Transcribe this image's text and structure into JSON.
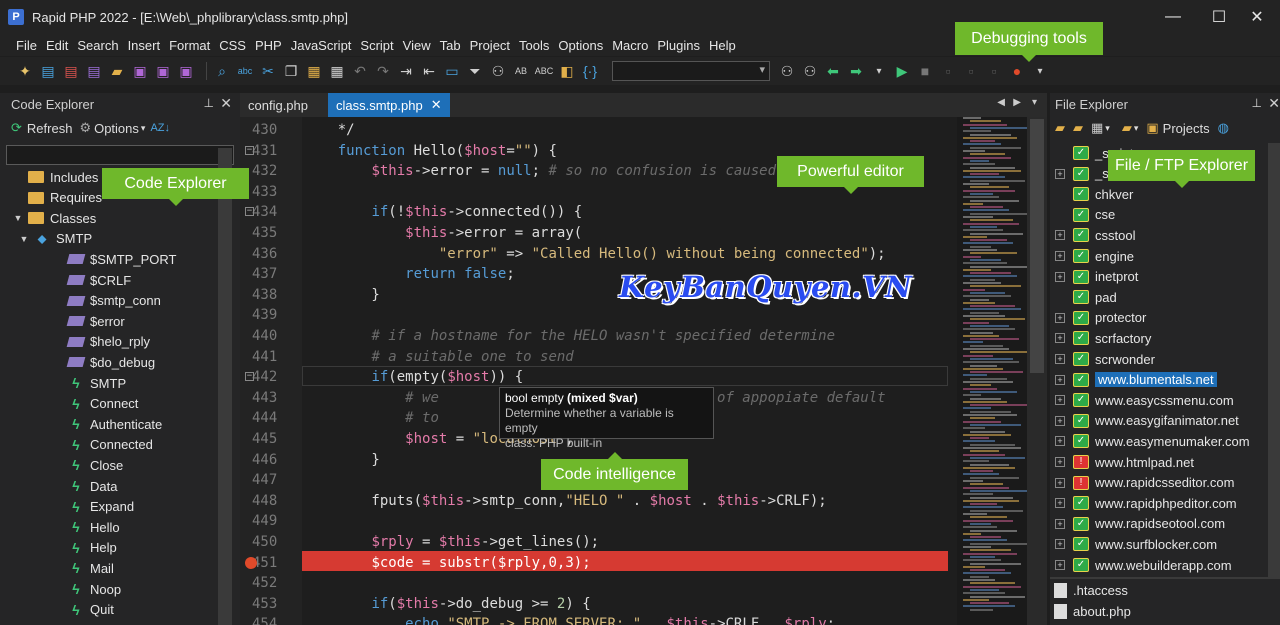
{
  "window": {
    "title": "Rapid PHP 2022 - [E:\\Web\\_phplibrary\\class.smtp.php]",
    "minimize": "—",
    "maximize": "☐",
    "close": "✕"
  },
  "menu": [
    "File",
    "Edit",
    "Search",
    "Insert",
    "Format",
    "CSS",
    "PHP",
    "JavaScript",
    "Script",
    "View",
    "Tab",
    "Project",
    "Tools",
    "Options",
    "Macro",
    "Plugins",
    "Help"
  ],
  "code_explorer": {
    "title": "Code Explorer",
    "refresh": "Refresh",
    "options": "Options",
    "search_placeholder": "",
    "tree": [
      {
        "label": "Includes",
        "type": "folder",
        "level": 0
      },
      {
        "label": "Requires",
        "type": "folder",
        "level": 0
      },
      {
        "label": "Classes",
        "type": "folder",
        "level": 0
      },
      {
        "label": "SMTP",
        "type": "class",
        "level": 1
      },
      {
        "label": "$SMTP_PORT",
        "type": "var",
        "level": 2
      },
      {
        "label": "$CRLF",
        "type": "var",
        "level": 2
      },
      {
        "label": "$smtp_conn",
        "type": "var",
        "level": 2
      },
      {
        "label": "$error",
        "type": "var",
        "level": 2
      },
      {
        "label": "$helo_rply",
        "type": "var",
        "level": 2
      },
      {
        "label": "$do_debug",
        "type": "var",
        "level": 2
      },
      {
        "label": "SMTP",
        "type": "func",
        "level": 2
      },
      {
        "label": "Connect",
        "type": "func",
        "level": 2
      },
      {
        "label": "Authenticate",
        "type": "func",
        "level": 2
      },
      {
        "label": "Connected",
        "type": "func",
        "level": 2
      },
      {
        "label": "Close",
        "type": "func",
        "level": 2
      },
      {
        "label": "Data",
        "type": "func",
        "level": 2
      },
      {
        "label": "Expand",
        "type": "func",
        "level": 2
      },
      {
        "label": "Hello",
        "type": "func",
        "level": 2
      },
      {
        "label": "Help",
        "type": "func",
        "level": 2
      },
      {
        "label": "Mail",
        "type": "func",
        "level": 2
      },
      {
        "label": "Noop",
        "type": "func",
        "level": 2
      },
      {
        "label": "Quit",
        "type": "func",
        "level": 2
      }
    ]
  },
  "tabs": [
    {
      "label": "config.php",
      "active": false
    },
    {
      "label": "class.smtp.php",
      "active": true
    }
  ],
  "editor": {
    "lines": [
      {
        "n": "430",
        "code": "    */"
      },
      {
        "n": "431",
        "code": "    function Hello($host=\"\") {"
      },
      {
        "n": "432",
        "code": "        $this->error = null; # so no confusion is caused"
      },
      {
        "n": "433",
        "code": ""
      },
      {
        "n": "434",
        "code": "        if(!$this->connected()) {"
      },
      {
        "n": "435",
        "code": "            $this->error = array("
      },
      {
        "n": "436",
        "code": "                \"error\" => \"Called Hello() without being connected\");"
      },
      {
        "n": "437",
        "code": "            return false;"
      },
      {
        "n": "438",
        "code": "        }"
      },
      {
        "n": "439",
        "code": ""
      },
      {
        "n": "440",
        "code": "        # if a hostname for the HELO wasn't specified determine"
      },
      {
        "n": "441",
        "code": "        # a suitable one to send"
      },
      {
        "n": "442",
        "code": "        if(empty($host)) {"
      },
      {
        "n": "443",
        "code": "            # we                            sort of appopiate default"
      },
      {
        "n": "444",
        "code": "            # to"
      },
      {
        "n": "445",
        "code": "            $host = \"localhost\";"
      },
      {
        "n": "446",
        "code": "        }"
      },
      {
        "n": "447",
        "code": ""
      },
      {
        "n": "448",
        "code": "        fputs($this->smtp_conn,\"HELO \" . $host . $this->CRLF);"
      },
      {
        "n": "449",
        "code": ""
      },
      {
        "n": "450",
        "code": "        $rply = $this->get_lines();"
      },
      {
        "n": "451",
        "code": "        $code = substr($rply,0,3);"
      },
      {
        "n": "452",
        "code": ""
      },
      {
        "n": "453",
        "code": "        if($this->do_debug >= 2) {"
      },
      {
        "n": "454",
        "code": "            echo \"SMTP -> FROM SERVER: \" . $this->CRLF . $rply;"
      }
    ],
    "tooltip": {
      "signature_prefix": "bool empty ",
      "signature_bold": "(mixed $var)",
      "description": "Determine whether a variable is empty",
      "class": "class: PHP built-in"
    }
  },
  "file_explorer": {
    "title": "File Explorer",
    "projects": "Projects",
    "folders": [
      {
        "label": "_scripts",
        "status": "ok",
        "expandable": false
      },
      {
        "label": "_styles",
        "status": "ok",
        "expandable": true
      },
      {
        "label": "chkver",
        "status": "ok",
        "expandable": false
      },
      {
        "label": "cse",
        "status": "ok",
        "expandable": false
      },
      {
        "label": "csstool",
        "status": "ok",
        "expandable": true
      },
      {
        "label": "engine",
        "status": "ok",
        "expandable": true
      },
      {
        "label": "inetprot",
        "status": "ok",
        "expandable": true
      },
      {
        "label": "pad",
        "status": "ok",
        "expandable": false
      },
      {
        "label": "protector",
        "status": "ok",
        "expandable": true
      },
      {
        "label": "scrfactory",
        "status": "ok",
        "expandable": true
      },
      {
        "label": "scrwonder",
        "status": "ok",
        "expandable": true
      },
      {
        "label": "www.blumentals.net",
        "status": "ok",
        "expandable": true,
        "selected": true
      },
      {
        "label": "www.easycssmenu.com",
        "status": "ok",
        "expandable": true
      },
      {
        "label": "www.easygifanimator.net",
        "status": "ok",
        "expandable": true
      },
      {
        "label": "www.easymenumaker.com",
        "status": "ok",
        "expandable": true
      },
      {
        "label": "www.htmlpad.net",
        "status": "err",
        "expandable": true
      },
      {
        "label": "www.rapidcsseditor.com",
        "status": "err",
        "expandable": true
      },
      {
        "label": "www.rapidphpeditor.com",
        "status": "ok",
        "expandable": true
      },
      {
        "label": "www.rapidseotool.com",
        "status": "ok",
        "expandable": true
      },
      {
        "label": "www.surfblocker.com",
        "status": "ok",
        "expandable": true
      },
      {
        "label": "www.webuilderapp.com",
        "status": "ok",
        "expandable": true
      }
    ],
    "files": [
      ".htaccess",
      "about.php"
    ]
  },
  "callouts": {
    "debugging": "Debugging tools",
    "code_explorer": "Code Explorer",
    "editor": "Powerful editor",
    "file_ftp": "File / FTP Explorer",
    "intelligence": "Code intelligence"
  },
  "watermark": "KeyBanQuyen.VN",
  "colors": {
    "accent": "#1e6fb8",
    "callout": "#6fb82b",
    "breakpoint_line": "#d63a32"
  }
}
